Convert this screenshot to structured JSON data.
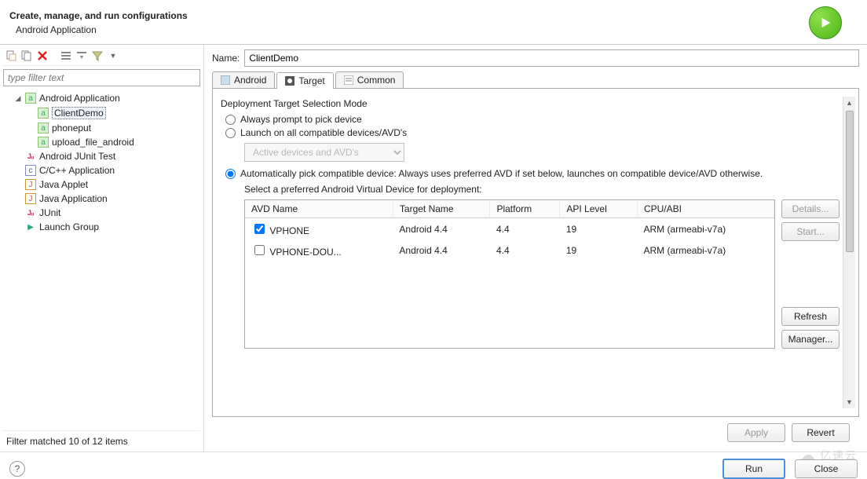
{
  "header": {
    "title": "Create, manage, and run configurations",
    "subtitle": "Android Application"
  },
  "filter": {
    "placeholder": "type filter text",
    "status": "Filter matched 10 of 12 items"
  },
  "tree": {
    "root": "Android Application",
    "children": [
      "ClientDemo",
      "phoneput",
      "upload_file_android"
    ],
    "siblings": [
      "Android JUnit Test",
      "C/C++ Application",
      "Java Applet",
      "Java Application",
      "JUnit",
      "Launch Group"
    ]
  },
  "name": {
    "label": "Name:",
    "value": "ClientDemo"
  },
  "tabs": {
    "android": "Android",
    "target": "Target",
    "common": "Common"
  },
  "target": {
    "group": "Deployment Target Selection Mode",
    "opt_prompt": "Always prompt to pick device",
    "opt_all": "Launch on all compatible devices/AVD's",
    "dropdown": "Active devices and AVD's",
    "opt_auto": "Automatically pick compatible device: Always uses preferred AVD if set below, launches on compatible device/AVD otherwise.",
    "avd_label": "Select a preferred Android Virtual Device for deployment:",
    "columns": {
      "name": "AVD Name",
      "target": "Target Name",
      "platform": "Platform",
      "api": "API Level",
      "cpu": "CPU/ABI"
    },
    "rows": [
      {
        "checked": true,
        "name": "VPHONE",
        "target": "Android 4.4",
        "platform": "4.4",
        "api": "19",
        "cpu": "ARM (armeabi-v7a)"
      },
      {
        "checked": false,
        "name": "VPHONE-DOU...",
        "target": "Android 4.4",
        "platform": "4.4",
        "api": "19",
        "cpu": "ARM (armeabi-v7a)"
      }
    ],
    "btn_details": "Details...",
    "btn_start": "Start...",
    "btn_refresh": "Refresh",
    "btn_manager": "Manager..."
  },
  "buttons": {
    "apply": "Apply",
    "revert": "Revert",
    "run": "Run",
    "close": "Close"
  },
  "watermark": "亿速云"
}
